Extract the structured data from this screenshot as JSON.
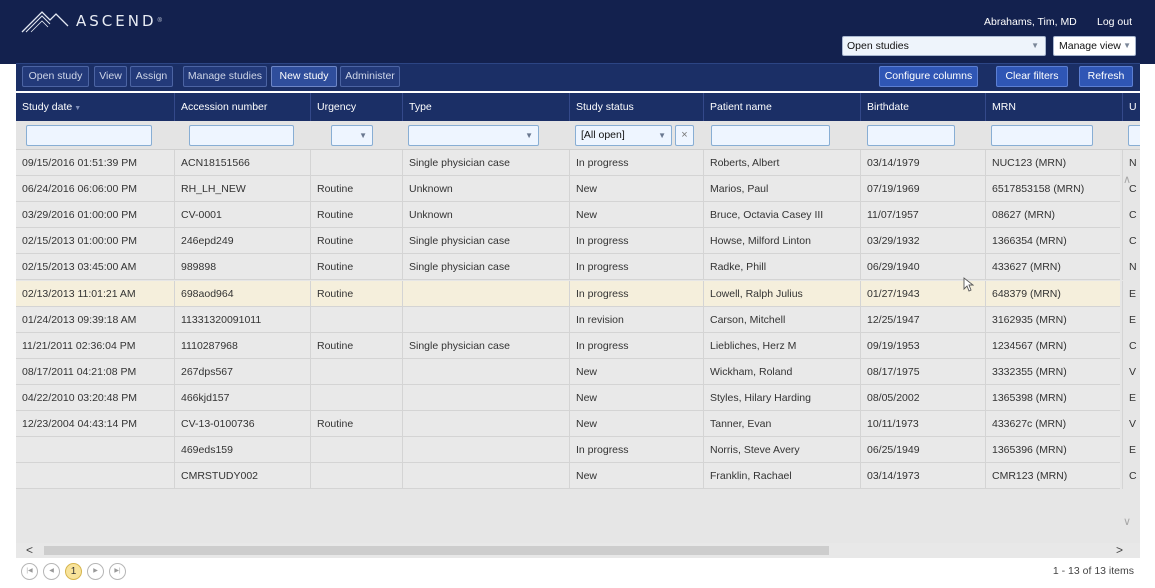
{
  "header": {
    "logo_text": "ASCEND",
    "logo_tm": "®",
    "user_name": "Abrahams, Tim, MD",
    "logout": "Log out",
    "view_selected": "Open studies",
    "manage_view": "Manage view"
  },
  "toolbar": {
    "buttons": [
      "Open study",
      "View",
      "Assign",
      "Manage studies",
      "New study",
      "Administer"
    ],
    "right_buttons": [
      "Configure columns",
      "Clear filters",
      "Refresh"
    ]
  },
  "columns": [
    "Study date",
    "Accession number",
    "Urgency",
    "Type",
    "Study status",
    "Patient name",
    "Birthdate",
    "MRN",
    "U"
  ],
  "filters": {
    "study_status": "[All open]",
    "clear": "×"
  },
  "rows": [
    {
      "date": "09/15/2016 01:51:39 PM",
      "accession": "ACN18151566",
      "urgency": "",
      "type": "Single physician case",
      "status": "In progress",
      "patient": "Roberts, Albert",
      "birthdate": "03/14/1979",
      "mrn": "NUC123 (MRN)",
      "extra": "N"
    },
    {
      "date": "06/24/2016 06:06:00 PM",
      "accession": "RH_LH_NEW",
      "urgency": "Routine",
      "type": "Unknown",
      "status": "New",
      "patient": "Marios, Paul",
      "birthdate": "07/19/1969",
      "mrn": "6517853158 (MRN)",
      "extra": "C"
    },
    {
      "date": "03/29/2016 01:00:00 PM",
      "accession": "CV-0001",
      "urgency": "Routine",
      "type": "Unknown",
      "status": "New",
      "patient": "Bruce, Octavia Casey III",
      "birthdate": "11/07/1957",
      "mrn": "08627 (MRN)",
      "extra": "C"
    },
    {
      "date": "02/15/2013 01:00:00 PM",
      "accession": "246epd249",
      "urgency": "Routine",
      "type": "Single physician case",
      "status": "In progress",
      "patient": "Howse, Milford Linton",
      "birthdate": "03/29/1932",
      "mrn": "1366354 (MRN)",
      "extra": "C"
    },
    {
      "date": "02/15/2013 03:45:00 AM",
      "accession": "989898",
      "urgency": "Routine",
      "type": "Single physician case",
      "status": "In progress",
      "patient": "Radke, Phill",
      "birthdate": "06/29/1940",
      "mrn": "433627 (MRN)",
      "extra": "N"
    },
    {
      "date": "02/13/2013 11:01:21 AM",
      "accession": "698aod964",
      "urgency": "Routine",
      "type": "",
      "status": "In progress",
      "patient": "Lowell, Ralph Julius",
      "birthdate": "01/27/1943",
      "mrn": "648379 (MRN)",
      "extra": "E"
    },
    {
      "date": "01/24/2013 09:39:18 AM",
      "accession": "11331320091011",
      "urgency": "",
      "type": "",
      "status": "In revision",
      "patient": "Carson, Mitchell",
      "birthdate": "12/25/1947",
      "mrn": "3162935 (MRN)",
      "extra": "E"
    },
    {
      "date": "11/21/2011 02:36:04 PM",
      "accession": "1110287968",
      "urgency": "Routine",
      "type": "Single physician case",
      "status": "In progress",
      "patient": "Liebliches, Herz M",
      "birthdate": "09/19/1953",
      "mrn": "1234567 (MRN)",
      "extra": "C"
    },
    {
      "date": "08/17/2011 04:21:08 PM",
      "accession": "267dps567",
      "urgency": "",
      "type": "",
      "status": "New",
      "patient": "Wickham, Roland",
      "birthdate": "08/17/1975",
      "mrn": "3332355 (MRN)",
      "extra": "V"
    },
    {
      "date": "04/22/2010 03:20:48 PM",
      "accession": "466kjd157",
      "urgency": "",
      "type": "",
      "status": "New",
      "patient": "Styles, Hilary Harding",
      "birthdate": "08/05/2002",
      "mrn": "1365398 (MRN)",
      "extra": "E"
    },
    {
      "date": "12/23/2004 04:43:14 PM",
      "accession": "CV-13-0100736",
      "urgency": "Routine",
      "type": "",
      "status": "New",
      "patient": "Tanner, Evan",
      "birthdate": "10/11/1973",
      "mrn": "433627c (MRN)",
      "extra": "V"
    },
    {
      "date": "",
      "accession": "469eds159",
      "urgency": "",
      "type": "",
      "status": "In progress",
      "patient": "Norris, Steve Avery",
      "birthdate": "06/25/1949",
      "mrn": "1365396 (MRN)",
      "extra": "E"
    },
    {
      "date": "",
      "accession": "CMRSTUDY002",
      "urgency": "",
      "type": "",
      "status": "New",
      "patient": "Franklin, Rachael",
      "birthdate": "03/14/1973",
      "mrn": "CMR123 (MRN)",
      "extra": "C"
    }
  ],
  "selected_row": 5,
  "pager": {
    "current_page": "1",
    "info": "1 - 13 of 13 items"
  },
  "colors": {
    "header_bg": "#13214e",
    "toolbar_bg": "#1b2f66",
    "selected_row": "#f5efdc",
    "current_page": "#f8e39a"
  }
}
